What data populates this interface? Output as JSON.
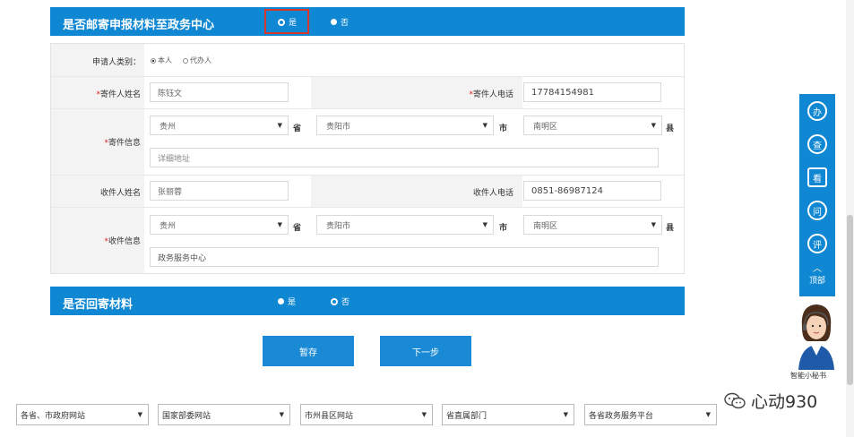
{
  "section1": {
    "title": "是否邮寄申报材料至政务中心",
    "option_yes": "是",
    "option_no": "否"
  },
  "applicant_type": {
    "label": "申请人类别：",
    "opt_self": "本人",
    "opt_agent": "代办人"
  },
  "sender": {
    "name_label": "寄件人姓名",
    "name_value": "陈钰文",
    "phone_label": "寄件人电话",
    "phone_value": "17784154981",
    "info_label": "寄件信息",
    "province": "贵州",
    "province_unit": "省",
    "city": "贵阳市",
    "city_unit": "市",
    "county": "南明区",
    "county_unit": "县",
    "address_placeholder": "详细地址",
    "required_mark": "*"
  },
  "receiver": {
    "name_label": "收件人姓名",
    "name_value": "张丽蓉",
    "phone_label": "收件人电话",
    "phone_value": "0851-86987124",
    "info_label": "收件信息",
    "province": "贵州",
    "province_unit": "省",
    "city": "贵阳市",
    "city_unit": "市",
    "county": "南明区",
    "county_unit": "县",
    "address_value": "政务服务中心",
    "required_mark": "*"
  },
  "section2": {
    "title": "是否回寄材料",
    "option_yes": "是",
    "option_no": "否"
  },
  "buttons": {
    "save": "暂存",
    "next": "下一步"
  },
  "sidebar": {
    "items": [
      "办",
      "查",
      "看",
      "问",
      "评"
    ],
    "top_label": "顶部",
    "assistant_label": "智能小秘书"
  },
  "footer": {
    "selects": [
      "各省、市政府网站",
      "国家部委网站",
      "市州县区网站",
      "省直属部门",
      "各省政务服务平台"
    ]
  },
  "watermark": "心动930",
  "colors": {
    "primary": "#0f87d2",
    "required": "#e02020",
    "highlight": "#d9352a"
  }
}
